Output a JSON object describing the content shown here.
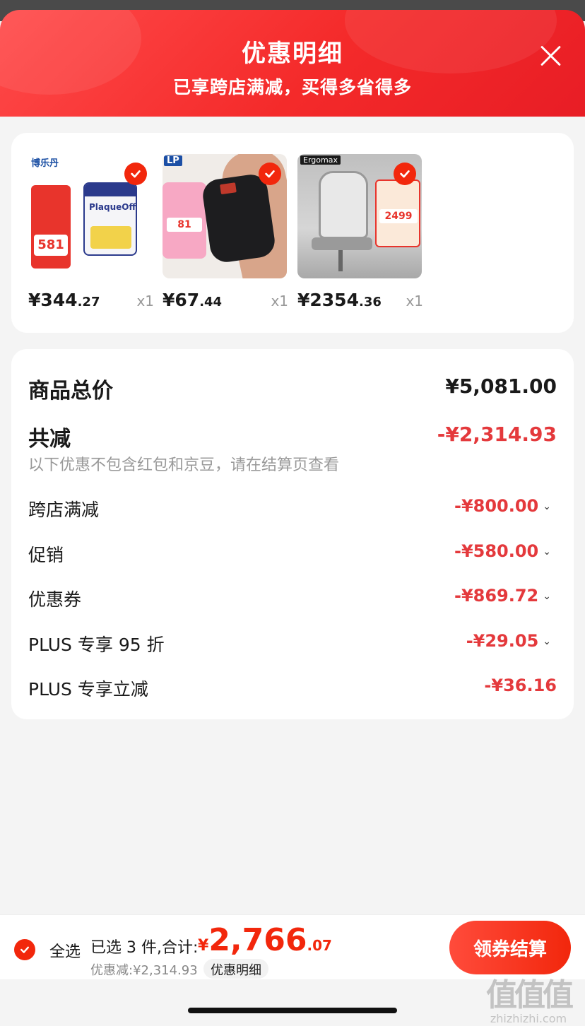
{
  "header": {
    "title": "优惠明细",
    "subtitle": "已享跨店满减，买得多省得多"
  },
  "products": [
    {
      "price_int": "¥344",
      "price_dec": ".27",
      "qty": "x1",
      "image": "plaqueoff-powder",
      "badge": "博乐丹",
      "promo": "581"
    },
    {
      "price_int": "¥67",
      "price_dec": ".44",
      "qty": "x1",
      "image": "elbow-sleeve",
      "badge": "LP",
      "promo": "81"
    },
    {
      "price_int": "¥2354",
      "price_dec": ".36",
      "qty": "x1",
      "image": "ergonomic-chair",
      "badge": "Ergomax",
      "promo": "2499"
    }
  ],
  "summary": {
    "total_label": "商品总价",
    "total_amount": "¥5,081.00",
    "reduce_label": "共减",
    "reduce_amount": "-¥2,314.93",
    "note": "以下优惠不包含红包和京豆，请在结算页查看",
    "items": [
      {
        "label": "跨店满减",
        "amount": "-¥800.00",
        "expandable": true
      },
      {
        "label": "促销",
        "amount": "-¥580.00",
        "expandable": true
      },
      {
        "label": "优惠券",
        "amount": "-¥869.72",
        "expandable": true
      },
      {
        "label": "PLUS 专享 95 折",
        "amount": "-¥29.05",
        "expandable": true
      },
      {
        "label": "PLUS 专享立减",
        "amount": "-¥36.16",
        "expandable": false
      }
    ]
  },
  "bottom": {
    "select_all": "全选",
    "selected": "已选 3 件,合计:",
    "total_symbol": "¥",
    "total_int": "2,766",
    "total_dec": ".07",
    "discount": "优惠减:¥2,314.93",
    "detail_button": "优惠明细",
    "checkout_button": "领券结算"
  },
  "watermark": {
    "logo": "值值值",
    "domain": "zhizhizhi.com"
  },
  "colors": {
    "accent": "#f2270c",
    "discount": "#e4393c",
    "header": "#f42a2a"
  }
}
